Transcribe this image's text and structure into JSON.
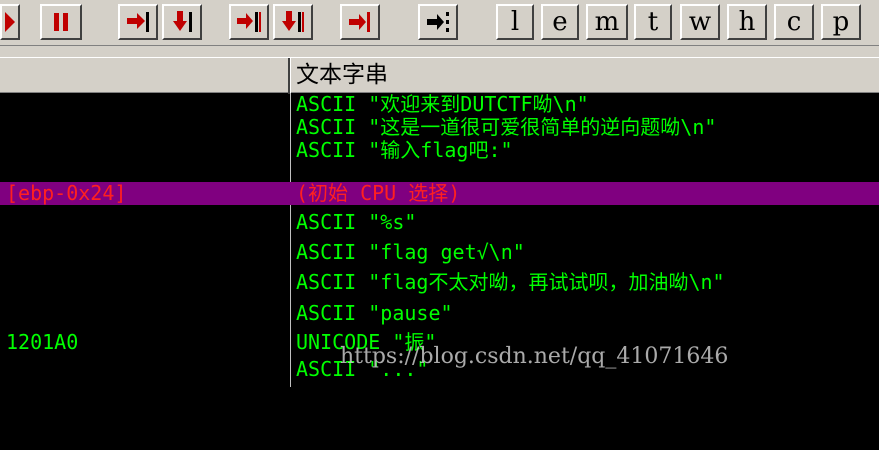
{
  "toolbar": {
    "letters": [
      "l",
      "e",
      "m",
      "t",
      "w",
      "h",
      "c",
      "p"
    ]
  },
  "header": {
    "comment_title": "文本字串"
  },
  "rows": [
    {
      "addr": "",
      "comment": "ASCII \"欢迎来到DUTCTF呦\\n\""
    },
    {
      "addr": "",
      "comment": "ASCII \"这是一道很可爱很简单的逆向题呦\\n\""
    },
    {
      "addr": "",
      "comment": "ASCII \"输入flag吧:\""
    },
    {
      "addr": "[ebp-0x24]",
      "comment": "(初始 CPU 选择)"
    },
    {
      "addr": "",
      "comment": "ASCII \"%s\""
    },
    {
      "addr": "",
      "comment": "ASCII \"flag get√\\n\""
    },
    {
      "addr": "",
      "comment": "ASCII \"flag不太对呦，再试试呗，加油呦\\n\""
    },
    {
      "addr": "",
      "comment": "ASCII \"pause\""
    },
    {
      "addr": "1201A0",
      "comment": "UNICODE \"振\""
    },
    {
      "addr": "",
      "comment": "ASCII \"...\""
    }
  ],
  "watermark": "https://blog.csdn.net/qq_41071646",
  "colors": {
    "text": "#00ff00",
    "selected_bg": "#800080",
    "selected_text": "#ff2020",
    "icon_red": "#c00000"
  }
}
